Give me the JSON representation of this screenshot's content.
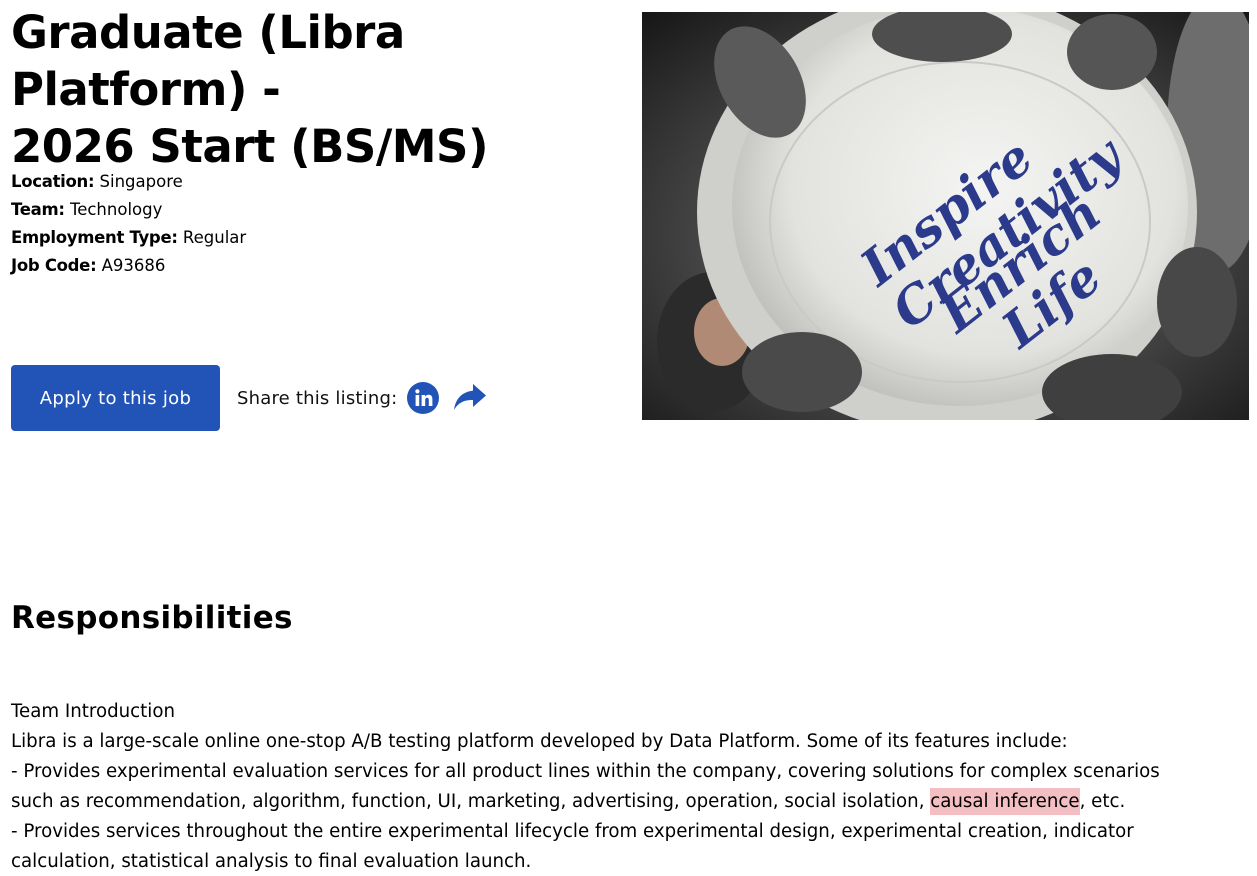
{
  "job": {
    "title": "Graduate (Libra Platform) -\n2026 Start (BS/MS)",
    "details": [
      {
        "label": "Location:",
        "value": "Singapore"
      },
      {
        "label": "Team:",
        "value": "Technology"
      },
      {
        "label": "Employment Type:",
        "value": "Regular"
      },
      {
        "label": "Job Code:",
        "value": "A93686"
      }
    ]
  },
  "actions": {
    "apply_label": "Apply to this job",
    "share_label": "Share this listing:",
    "linkedin_icon": "linkedin-icon",
    "share_icon": "share-arrow-icon"
  },
  "hero_image": {
    "frisbee_text": [
      "Inspire",
      "Creativity",
      "Enrich",
      "Life"
    ]
  },
  "responsibilities": {
    "heading": "Responsibilities",
    "team_intro": "Team Introduction",
    "intro": "Libra is a large-scale online one-stop A/B testing platform developed by Data Platform. Some of its features include:",
    "bullet1_line1": "- Provides experimental evaluation services for all product lines within the company, covering solutions for complex scenarios",
    "bullet1_line2_prefix": "such as recommendation, algorithm, function, UI, marketing, advertising, operation, social isolation, ",
    "bullet1_highlight": "causal inference",
    "bullet1_line2_suffix": ", etc.",
    "bullet2_line1": "- Provides services throughout the entire experimental lifecycle from experimental design, experimental creation, indicator",
    "bullet2_line2": "calculation, statistical analysis to final evaluation launch."
  },
  "colors": {
    "primary": "#2254b8",
    "highlight": "#f4bfc3",
    "frisbee_ink": "#2b3a8a"
  }
}
